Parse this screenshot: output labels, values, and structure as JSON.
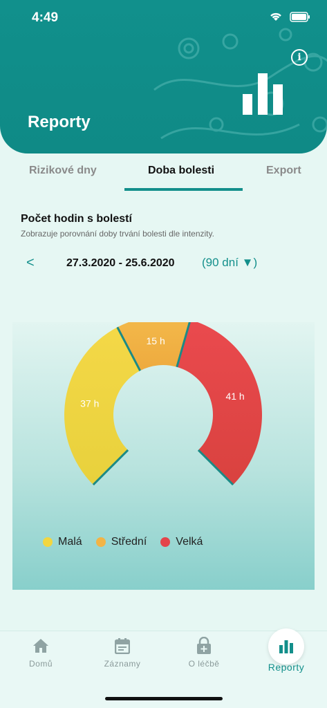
{
  "status": {
    "time": "4:49"
  },
  "header": {
    "title": "Reporty"
  },
  "tabs": [
    {
      "label": "Rizikové dny"
    },
    {
      "label": "Doba bolesti"
    },
    {
      "label": "Export"
    }
  ],
  "report": {
    "subtitle": "Zobrazuje porovnání doby trvání bolesti dle intenzity.",
    "prev": "<",
    "date_range": "27.3.2020 - 25.6.2020",
    "period": "(90 dní ▼)"
  },
  "chart_data": {
    "type": "pie",
    "title": "Počet hodin s bolestí",
    "categories": [
      "Malá",
      "Střední",
      "Velká"
    ],
    "values": [
      37,
      15,
      41
    ],
    "labels": [
      "37 h",
      "15 h",
      "41 h"
    ],
    "colors": [
      "#f2d640",
      "#f2b446",
      "#e4454b"
    ],
    "legend": "bottom"
  },
  "nav": [
    {
      "label": "Domů",
      "icon": "home-icon"
    },
    {
      "label": "Záznamy",
      "icon": "calendar-icon"
    },
    {
      "label": "O léčbě",
      "icon": "lock-plus-icon"
    },
    {
      "label": "Reporty",
      "icon": "bar-chart-icon"
    }
  ],
  "colors": {
    "accent": "#138f8b",
    "header": "#11908c"
  }
}
